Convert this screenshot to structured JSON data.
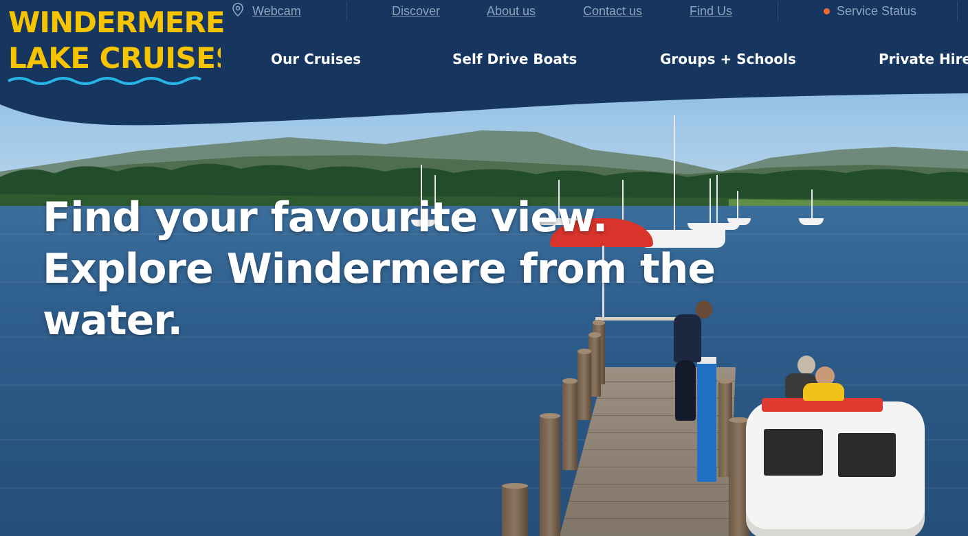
{
  "brand": {
    "logo_line1": "WINDERMERE",
    "logo_line2": "LAKE CRUISES",
    "logo_color": "#f6c400",
    "wave_color": "#2ab3e6"
  },
  "topbar": {
    "webcam": "Webcam",
    "discover": "Discover",
    "about": "About us",
    "contact": "Contact us",
    "find_us": "Find Us",
    "service_status": "Service Status",
    "status_color": "#f26a2e"
  },
  "nav": {
    "items": [
      {
        "label": "Our Cruises"
      },
      {
        "label": "Self Drive Boats"
      },
      {
        "label": "Groups + Schools"
      },
      {
        "label": "Private Hire"
      }
    ]
  },
  "hero": {
    "line1": "Find your favourite view.",
    "line2": "Explore Windermere from the",
    "line3": "water."
  },
  "colors": {
    "header_bg": "#163660",
    "nav_bg": "#163660",
    "link_color": "#8ea3bd"
  }
}
